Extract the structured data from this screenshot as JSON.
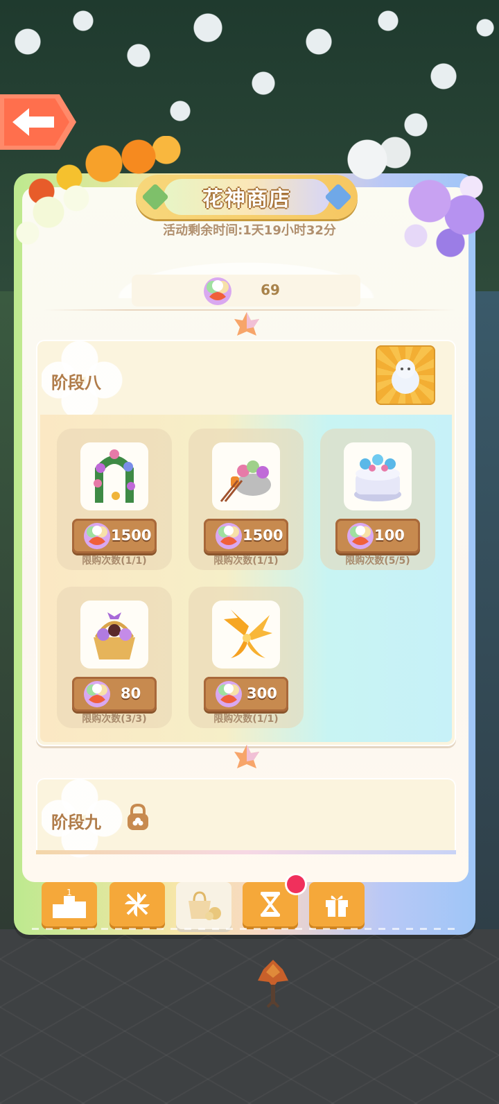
{
  "shop": {
    "title": "花神商店",
    "timer": "活动剩余时间:1天19小时32分",
    "currency_amount": "69"
  },
  "stages": [
    {
      "title": "阶段八",
      "items": [
        {
          "name": "flower-arch",
          "price": "1500",
          "limit": "限购次数(1/1)"
        },
        {
          "name": "flower-cart",
          "price": "1500",
          "limit": "限购次数(1/1)"
        },
        {
          "name": "blue-cake",
          "price": "100",
          "limit": "限购次数(5/5)"
        },
        {
          "name": "flower-basket",
          "price": "80",
          "limit": "限购次数(3/3)"
        },
        {
          "name": "golden-wings",
          "price": "300",
          "limit": "限购次数(1/1)"
        }
      ]
    },
    {
      "title": "阶段九",
      "locked": true
    }
  ],
  "tabs": [
    {
      "name": "ranking",
      "icon": "podium-icon",
      "label": "1"
    },
    {
      "name": "pinwheel",
      "icon": "pinwheel-icon"
    },
    {
      "name": "shop",
      "icon": "shop-bag-icon",
      "active": true
    },
    {
      "name": "hourglass",
      "icon": "hourglass-icon",
      "has_badge": true
    },
    {
      "name": "gift",
      "icon": "gift-icon"
    }
  ],
  "colors": {
    "accent_orange": "#f5a83a",
    "price_button": "#c78a4f",
    "badge_red": "#f0305c",
    "title_brown": "#b07c4a"
  }
}
